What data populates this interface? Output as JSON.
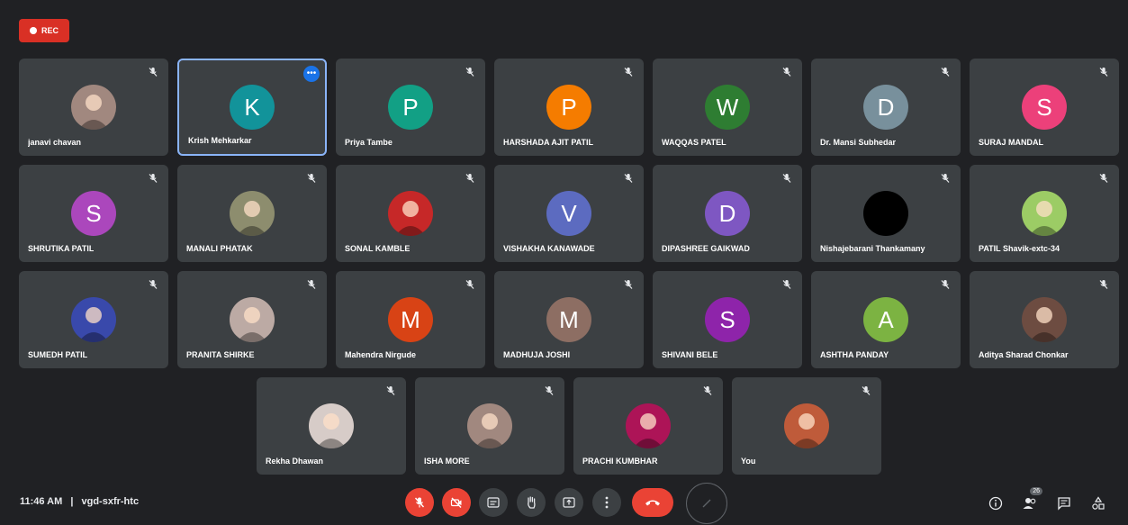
{
  "recording": {
    "label": "REC"
  },
  "participants": [
    {
      "name": "janavi chavan",
      "type": "photo",
      "tone": "#a1887f"
    },
    {
      "name": "Krish Mehkarkar",
      "type": "letter",
      "initial": "K",
      "color": "#12939a",
      "active": true
    },
    {
      "name": "Priya Tambe",
      "type": "letter",
      "initial": "P",
      "color": "#12a085"
    },
    {
      "name": "HARSHADA AJIT PATIL",
      "type": "letter",
      "initial": "P",
      "color": "#f57c00"
    },
    {
      "name": "WAQQAS PATEL",
      "type": "letter",
      "initial": "W",
      "color": "#2e7d32"
    },
    {
      "name": "Dr. Mansi Subhedar",
      "type": "letter",
      "initial": "D",
      "color": "#78909c"
    },
    {
      "name": "SURAJ MANDAL",
      "type": "letter",
      "initial": "S",
      "color": "#ec407a"
    },
    {
      "name": "SHRUTIKA PATIL",
      "type": "letter",
      "initial": "S",
      "color": "#ab47bc"
    },
    {
      "name": "MANALI PHATAK",
      "type": "photo",
      "tone": "#8d8d6e"
    },
    {
      "name": "SONAL KAMBLE",
      "type": "photo",
      "tone": "#c62828"
    },
    {
      "name": "VISHAKHA KANAWADE",
      "type": "letter",
      "initial": "V",
      "color": "#5c6bc0"
    },
    {
      "name": "DIPASHREE GAIKWAD",
      "type": "letter",
      "initial": "D",
      "color": "#7e57c2"
    },
    {
      "name": "Nishajebarani Thankamany",
      "type": "photo",
      "tone": "#000000"
    },
    {
      "name": "PATIL Shavik-extc-34",
      "type": "photo",
      "tone": "#9ccc65"
    },
    {
      "name": "SUMEDH PATIL",
      "type": "photo",
      "tone": "#3949ab"
    },
    {
      "name": "PRANITA SHIRKE",
      "type": "photo",
      "tone": "#bcaaa4"
    },
    {
      "name": "Mahendra Nirgude",
      "type": "letter",
      "initial": "M",
      "color": "#d84315"
    },
    {
      "name": "MADHUJA JOSHI",
      "type": "letter",
      "initial": "M",
      "color": "#8d6e63"
    },
    {
      "name": "SHIVANI BELE",
      "type": "letter",
      "initial": "S",
      "color": "#8e24aa"
    },
    {
      "name": "ASHTHA PANDAY",
      "type": "letter",
      "initial": "A",
      "color": "#7cb342"
    },
    {
      "name": "Aditya Sharad Chonkar",
      "type": "photo",
      "tone": "#6d4c41"
    },
    {
      "name": "Rekha Dhawan",
      "type": "photo",
      "tone": "#d7ccc8"
    },
    {
      "name": "ISHA MORE",
      "type": "photo",
      "tone": "#a1887f"
    },
    {
      "name": "PRACHI KUMBHAR",
      "type": "photo",
      "tone": "#ad1457"
    },
    {
      "name": "You",
      "type": "photo",
      "tone": "#bf5b3a"
    }
  ],
  "bottom_bar": {
    "time": "11:46 AM",
    "separator": "|",
    "meeting_code": "vgd-sxfr-htc",
    "people_count": "26"
  }
}
